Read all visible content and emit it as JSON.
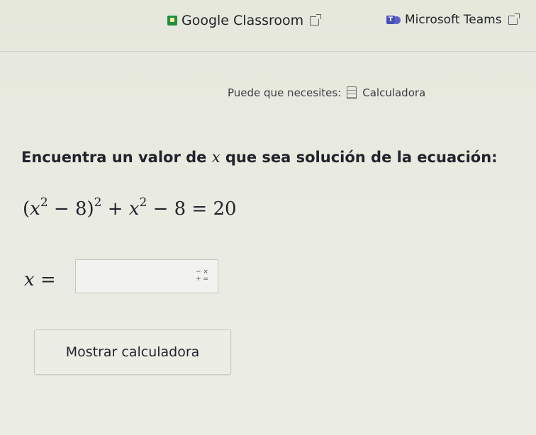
{
  "share": {
    "classroom_label": "Google Classroom",
    "teams_label": "Microsoft Teams"
  },
  "hint": {
    "prefix": "Puede que necesites:",
    "tool_label": "Calculadora"
  },
  "question": {
    "text_before": "Encuentra un valor de ",
    "variable": "x",
    "text_after": " que sea solución de la ecuación:",
    "equation": {
      "open": "(",
      "var": "x",
      "exp_inner": "2",
      "minus_const": " − 8)",
      "exp_outer": "2",
      "plus": " + ",
      "var2": "x",
      "exp2": "2",
      "rest": " − 8 = 20"
    }
  },
  "answer": {
    "label_var": "x",
    "label_eq": " =",
    "value": "",
    "placeholder": "",
    "ops_top": "− ×",
    "ops_bottom": "+ ="
  },
  "buttons": {
    "show_calculator": "Mostrar calculadora"
  },
  "colors": {
    "classroom_green": "#1e8e3e",
    "teams_purple": "#464eb8",
    "text": "#21242c"
  }
}
